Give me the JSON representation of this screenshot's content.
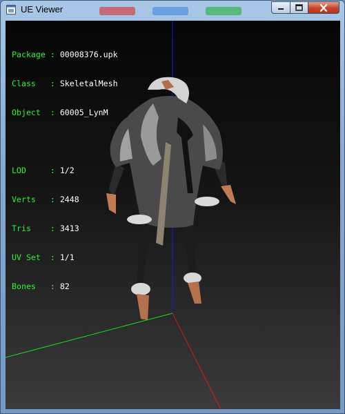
{
  "window": {
    "title": "UE Viewer",
    "title_bar_decor_colors": [
      "#d23a3a",
      "#4a8ae0",
      "#2fb24a"
    ],
    "controls": [
      "minimize-icon",
      "maximize-icon",
      "close-icon"
    ]
  },
  "info_panel": {
    "mesh": [
      {
        "key": "Package",
        "sep": " : ",
        "value": "00008376.upk"
      },
      {
        "key": "Class  ",
        "sep": " : ",
        "value": "SkeletalMesh"
      },
      {
        "key": "Object ",
        "sep": " : ",
        "value": "60005_LynM"
      }
    ],
    "stats": [
      {
        "key": "LOD    ",
        "sep": " : ",
        "value": "1/2"
      },
      {
        "key": "Verts  ",
        "sep": " : ",
        "value": "2448"
      },
      {
        "key": "Tris   ",
        "sep": " : ",
        "value": "3413"
      },
      {
        "key": "UV Set ",
        "sep": " : ",
        "value": "1/1"
      },
      {
        "key": "Bones  ",
        "sep": " : ",
        "value": "82"
      }
    ],
    "label_color": "#30f030",
    "value_color": "#ffffff"
  },
  "axes": {
    "x_color": "#e01818",
    "y_color": "#18e018",
    "z_color": "#1818e8"
  },
  "viewport": {
    "background_top": "#060606",
    "background_bottom": "#3b3b3b"
  }
}
